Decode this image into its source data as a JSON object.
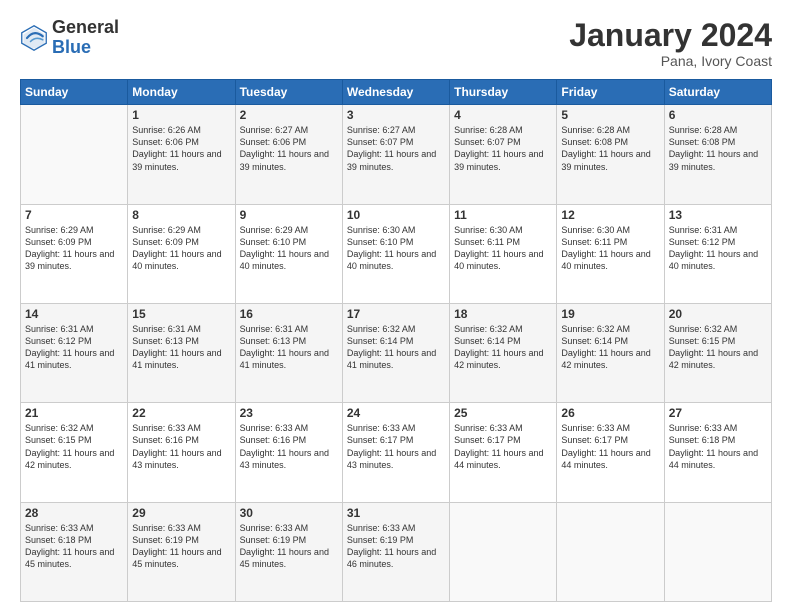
{
  "logo": {
    "general": "General",
    "blue": "Blue"
  },
  "header": {
    "month": "January 2024",
    "location": "Pana, Ivory Coast"
  },
  "weekdays": [
    "Sunday",
    "Monday",
    "Tuesday",
    "Wednesday",
    "Thursday",
    "Friday",
    "Saturday"
  ],
  "weeks": [
    [
      {
        "day": "",
        "sunrise": "",
        "sunset": "",
        "daylight": ""
      },
      {
        "day": "1",
        "sunrise": "Sunrise: 6:26 AM",
        "sunset": "Sunset: 6:06 PM",
        "daylight": "Daylight: 11 hours and 39 minutes."
      },
      {
        "day": "2",
        "sunrise": "Sunrise: 6:27 AM",
        "sunset": "Sunset: 6:06 PM",
        "daylight": "Daylight: 11 hours and 39 minutes."
      },
      {
        "day": "3",
        "sunrise": "Sunrise: 6:27 AM",
        "sunset": "Sunset: 6:07 PM",
        "daylight": "Daylight: 11 hours and 39 minutes."
      },
      {
        "day": "4",
        "sunrise": "Sunrise: 6:28 AM",
        "sunset": "Sunset: 6:07 PM",
        "daylight": "Daylight: 11 hours and 39 minutes."
      },
      {
        "day": "5",
        "sunrise": "Sunrise: 6:28 AM",
        "sunset": "Sunset: 6:08 PM",
        "daylight": "Daylight: 11 hours and 39 minutes."
      },
      {
        "day": "6",
        "sunrise": "Sunrise: 6:28 AM",
        "sunset": "Sunset: 6:08 PM",
        "daylight": "Daylight: 11 hours and 39 minutes."
      }
    ],
    [
      {
        "day": "7",
        "sunrise": "Sunrise: 6:29 AM",
        "sunset": "Sunset: 6:09 PM",
        "daylight": "Daylight: 11 hours and 39 minutes."
      },
      {
        "day": "8",
        "sunrise": "Sunrise: 6:29 AM",
        "sunset": "Sunset: 6:09 PM",
        "daylight": "Daylight: 11 hours and 40 minutes."
      },
      {
        "day": "9",
        "sunrise": "Sunrise: 6:29 AM",
        "sunset": "Sunset: 6:10 PM",
        "daylight": "Daylight: 11 hours and 40 minutes."
      },
      {
        "day": "10",
        "sunrise": "Sunrise: 6:30 AM",
        "sunset": "Sunset: 6:10 PM",
        "daylight": "Daylight: 11 hours and 40 minutes."
      },
      {
        "day": "11",
        "sunrise": "Sunrise: 6:30 AM",
        "sunset": "Sunset: 6:11 PM",
        "daylight": "Daylight: 11 hours and 40 minutes."
      },
      {
        "day": "12",
        "sunrise": "Sunrise: 6:30 AM",
        "sunset": "Sunset: 6:11 PM",
        "daylight": "Daylight: 11 hours and 40 minutes."
      },
      {
        "day": "13",
        "sunrise": "Sunrise: 6:31 AM",
        "sunset": "Sunset: 6:12 PM",
        "daylight": "Daylight: 11 hours and 40 minutes."
      }
    ],
    [
      {
        "day": "14",
        "sunrise": "Sunrise: 6:31 AM",
        "sunset": "Sunset: 6:12 PM",
        "daylight": "Daylight: 11 hours and 41 minutes."
      },
      {
        "day": "15",
        "sunrise": "Sunrise: 6:31 AM",
        "sunset": "Sunset: 6:13 PM",
        "daylight": "Daylight: 11 hours and 41 minutes."
      },
      {
        "day": "16",
        "sunrise": "Sunrise: 6:31 AM",
        "sunset": "Sunset: 6:13 PM",
        "daylight": "Daylight: 11 hours and 41 minutes."
      },
      {
        "day": "17",
        "sunrise": "Sunrise: 6:32 AM",
        "sunset": "Sunset: 6:14 PM",
        "daylight": "Daylight: 11 hours and 41 minutes."
      },
      {
        "day": "18",
        "sunrise": "Sunrise: 6:32 AM",
        "sunset": "Sunset: 6:14 PM",
        "daylight": "Daylight: 11 hours and 42 minutes."
      },
      {
        "day": "19",
        "sunrise": "Sunrise: 6:32 AM",
        "sunset": "Sunset: 6:14 PM",
        "daylight": "Daylight: 11 hours and 42 minutes."
      },
      {
        "day": "20",
        "sunrise": "Sunrise: 6:32 AM",
        "sunset": "Sunset: 6:15 PM",
        "daylight": "Daylight: 11 hours and 42 minutes."
      }
    ],
    [
      {
        "day": "21",
        "sunrise": "Sunrise: 6:32 AM",
        "sunset": "Sunset: 6:15 PM",
        "daylight": "Daylight: 11 hours and 42 minutes."
      },
      {
        "day": "22",
        "sunrise": "Sunrise: 6:33 AM",
        "sunset": "Sunset: 6:16 PM",
        "daylight": "Daylight: 11 hours and 43 minutes."
      },
      {
        "day": "23",
        "sunrise": "Sunrise: 6:33 AM",
        "sunset": "Sunset: 6:16 PM",
        "daylight": "Daylight: 11 hours and 43 minutes."
      },
      {
        "day": "24",
        "sunrise": "Sunrise: 6:33 AM",
        "sunset": "Sunset: 6:17 PM",
        "daylight": "Daylight: 11 hours and 43 minutes."
      },
      {
        "day": "25",
        "sunrise": "Sunrise: 6:33 AM",
        "sunset": "Sunset: 6:17 PM",
        "daylight": "Daylight: 11 hours and 44 minutes."
      },
      {
        "day": "26",
        "sunrise": "Sunrise: 6:33 AM",
        "sunset": "Sunset: 6:17 PM",
        "daylight": "Daylight: 11 hours and 44 minutes."
      },
      {
        "day": "27",
        "sunrise": "Sunrise: 6:33 AM",
        "sunset": "Sunset: 6:18 PM",
        "daylight": "Daylight: 11 hours and 44 minutes."
      }
    ],
    [
      {
        "day": "28",
        "sunrise": "Sunrise: 6:33 AM",
        "sunset": "Sunset: 6:18 PM",
        "daylight": "Daylight: 11 hours and 45 minutes."
      },
      {
        "day": "29",
        "sunrise": "Sunrise: 6:33 AM",
        "sunset": "Sunset: 6:19 PM",
        "daylight": "Daylight: 11 hours and 45 minutes."
      },
      {
        "day": "30",
        "sunrise": "Sunrise: 6:33 AM",
        "sunset": "Sunset: 6:19 PM",
        "daylight": "Daylight: 11 hours and 45 minutes."
      },
      {
        "day": "31",
        "sunrise": "Sunrise: 6:33 AM",
        "sunset": "Sunset: 6:19 PM",
        "daylight": "Daylight: 11 hours and 46 minutes."
      },
      {
        "day": "",
        "sunrise": "",
        "sunset": "",
        "daylight": ""
      },
      {
        "day": "",
        "sunrise": "",
        "sunset": "",
        "daylight": ""
      },
      {
        "day": "",
        "sunrise": "",
        "sunset": "",
        "daylight": ""
      }
    ]
  ]
}
